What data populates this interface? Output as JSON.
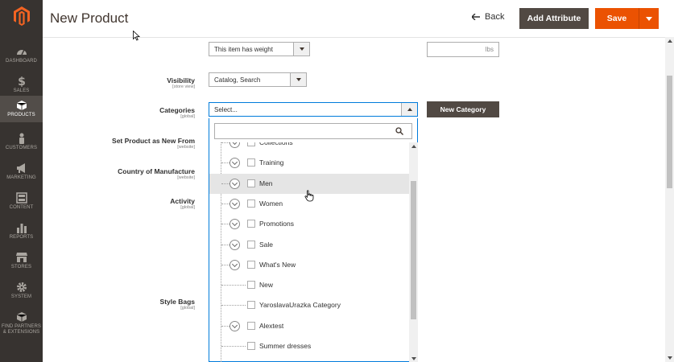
{
  "colors": {
    "sidebar": "#373330",
    "active": "#524d49",
    "primary": "#eb5202",
    "dark_button": "#514943",
    "focus": "#007bdb"
  },
  "sidebar": {
    "items": [
      {
        "label": "DASHBOARD",
        "icon": "gauge-icon"
      },
      {
        "label": "SALES",
        "icon": "dollar-icon"
      },
      {
        "label": "PRODUCTS",
        "icon": "cube-icon",
        "active": true
      },
      {
        "label": "CUSTOMERS",
        "icon": "person-icon"
      },
      {
        "label": "MARKETING",
        "icon": "megaphone-icon"
      },
      {
        "label": "CONTENT",
        "icon": "layout-icon"
      },
      {
        "label": "REPORTS",
        "icon": "bar-chart-icon"
      },
      {
        "label": "STORES",
        "icon": "store-icon"
      },
      {
        "label": "SYSTEM",
        "icon": "gear-icon"
      },
      {
        "label": "FIND PARTNERS",
        "label2": "& EXTENSIONS",
        "icon": "puzzle-box-icon"
      }
    ]
  },
  "header": {
    "title": "New Product",
    "back_label": "Back",
    "add_attribute_label": "Add Attribute",
    "save_label": "Save"
  },
  "form": {
    "weight": {
      "select_value": "This item has weight",
      "unit_placeholder": "lbs"
    },
    "visibility": {
      "label": "Visibility",
      "scope": "[store view]",
      "value": "Catalog, Search"
    },
    "categories": {
      "label": "Categories",
      "scope": "[global]",
      "value": "Select...",
      "new_category_label": "New Category"
    },
    "set_new_from": {
      "label": "Set Product as New From",
      "scope": "[website]"
    },
    "country": {
      "label": "Country of Manufacture",
      "scope": "[website]"
    },
    "activity": {
      "label": "Activity",
      "scope": "[global]"
    },
    "style_bags": {
      "label": "Style Bags",
      "scope": "[global]"
    }
  },
  "category_tree": [
    {
      "label": "Collections",
      "expandable": true
    },
    {
      "label": "Training",
      "expandable": true
    },
    {
      "label": "Men",
      "expandable": true,
      "hover": true
    },
    {
      "label": "Women",
      "expandable": true
    },
    {
      "label": "Promotions",
      "expandable": true
    },
    {
      "label": "Sale",
      "expandable": true
    },
    {
      "label": "What's New",
      "expandable": true
    },
    {
      "label": "New",
      "expandable": false
    },
    {
      "label": "YaroslavaUrazka Category",
      "expandable": false
    },
    {
      "label": "Alextest",
      "expandable": true
    },
    {
      "label": "Summer dresses",
      "expandable": false
    }
  ]
}
